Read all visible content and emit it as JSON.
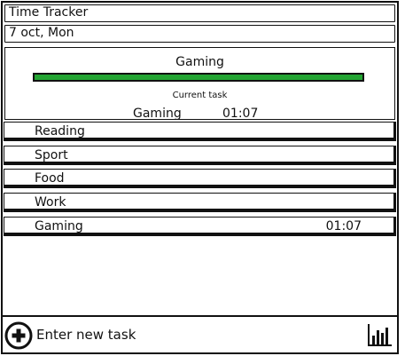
{
  "app": {
    "title": "Time Tracker"
  },
  "date": {
    "label": "7 oct, Mon"
  },
  "current": {
    "name": "Gaming",
    "label": "Current task",
    "task": "Gaming",
    "time": "01:07",
    "progress": 1.0,
    "progress_color": "#24a533"
  },
  "tasks": [
    {
      "label": "Reading",
      "time": ""
    },
    {
      "label": "Sport",
      "time": ""
    },
    {
      "label": "Food",
      "time": ""
    },
    {
      "label": "Work",
      "time": ""
    },
    {
      "label": "Gaming",
      "time": "01:07"
    }
  ],
  "bottom": {
    "placeholder": "Enter new task",
    "add_icon": "plus-circle-icon",
    "stats_icon": "bar-chart-icon"
  }
}
